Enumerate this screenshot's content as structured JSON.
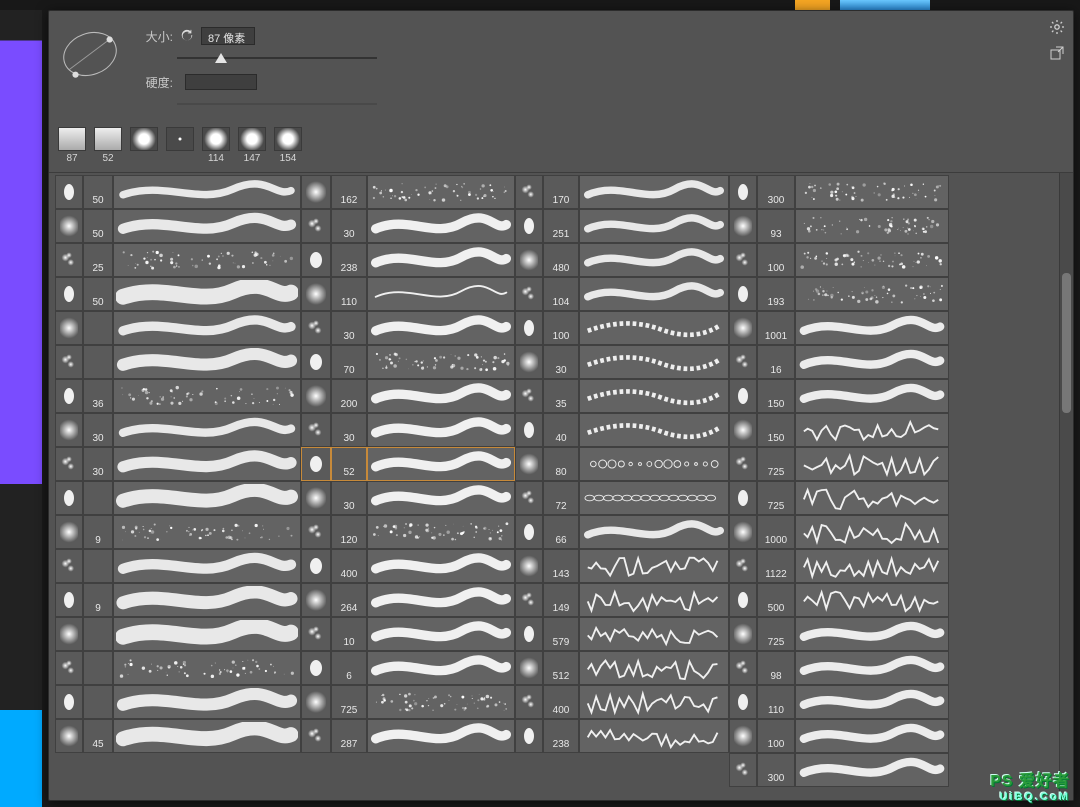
{
  "header": {
    "size_label": "大小:",
    "size_value": "87 像素",
    "hardness_label": "硬度:",
    "reset_tooltip": "reset"
  },
  "recent_brushes": [
    {
      "size": "87",
      "kind": "square"
    },
    {
      "size": "52",
      "kind": "square"
    },
    {
      "size": "",
      "kind": "soft"
    },
    {
      "size": "",
      "kind": "tiny"
    },
    {
      "size": "114",
      "kind": "soft"
    },
    {
      "size": "147",
      "kind": "soft"
    },
    {
      "size": "154",
      "kind": "soft"
    }
  ],
  "columns": [
    {
      "sizes": [
        "50",
        "50",
        "25",
        "50",
        "",
        "",
        "36",
        "30",
        "30",
        "",
        "9",
        "",
        "9",
        "",
        "",
        "",
        "45"
      ]
    },
    {
      "sizes": [
        "162",
        "30",
        "238",
        "110",
        "30",
        "70",
        "200",
        "30",
        "52",
        "30",
        "120",
        "400",
        "264",
        "10",
        "6",
        "725",
        "287"
      ]
    },
    {
      "sizes": [
        "170",
        "251",
        "480",
        "104",
        "100",
        "30",
        "35",
        "40",
        "80",
        "72",
        "66",
        "143",
        "149",
        "579",
        "512",
        "400",
        "238"
      ]
    },
    {
      "sizes": [
        "300",
        "93",
        "100",
        "193",
        "1001",
        "16",
        "150",
        "150",
        "725",
        "725",
        "1000",
        "1122",
        "500",
        "725",
        "98",
        "110",
        "100",
        "300"
      ]
    }
  ],
  "selected": {
    "col_group": 1,
    "row": 8
  },
  "watermark": {
    "line1": "PS 爱好者",
    "line2": "UiBQ.CoM"
  }
}
